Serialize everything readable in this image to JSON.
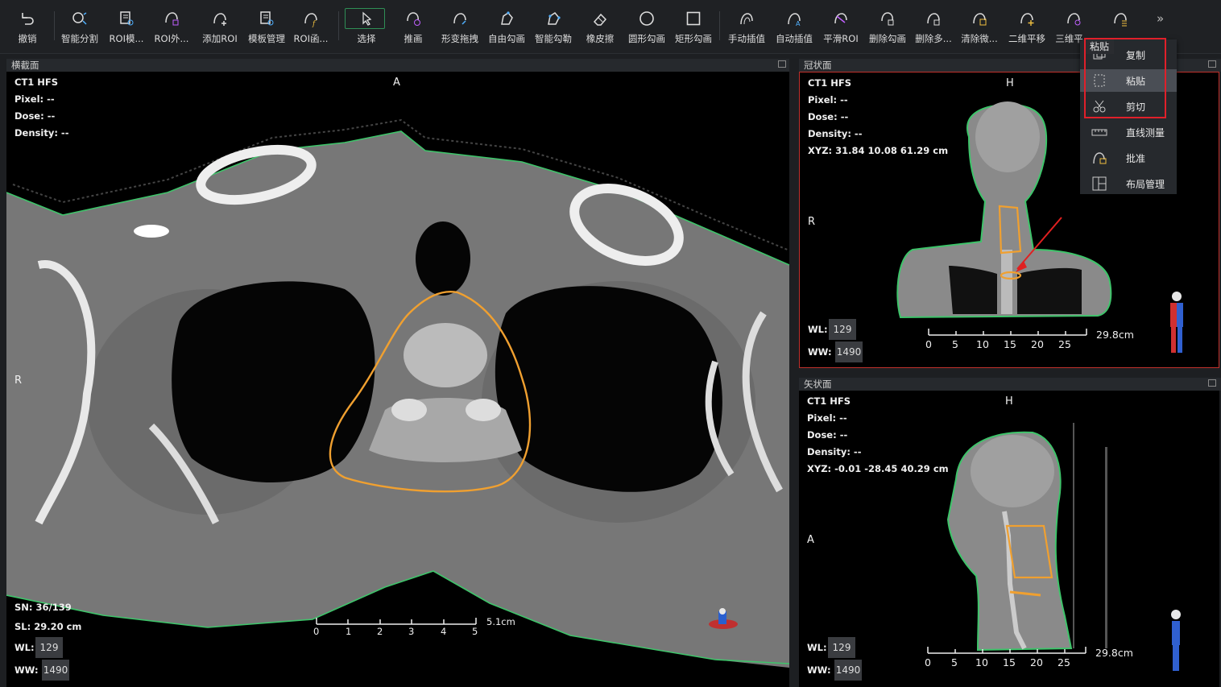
{
  "toolbar": {
    "items": [
      {
        "label": "撤销",
        "icon": "undo-icon"
      },
      {
        "label": "智能分割",
        "icon": "smart-segment-icon"
      },
      {
        "label": "ROI模...",
        "icon": "roi-template-icon"
      },
      {
        "label": "ROI外...",
        "icon": "roi-expand-icon"
      },
      {
        "label": "添加ROI",
        "icon": "add-roi-icon"
      },
      {
        "label": "模板管理",
        "icon": "template-manage-icon"
      },
      {
        "label": "ROI函...",
        "icon": "roi-function-icon"
      },
      {
        "label": "选择",
        "icon": "select-arrow-icon"
      },
      {
        "label": "推画",
        "icon": "push-draw-icon"
      },
      {
        "label": "形变拖拽",
        "icon": "deform-drag-icon"
      },
      {
        "label": "自由勾画",
        "icon": "free-draw-icon"
      },
      {
        "label": "智能勾勒",
        "icon": "smart-outline-icon"
      },
      {
        "label": "橡皮擦",
        "icon": "eraser-icon"
      },
      {
        "label": "圆形勾画",
        "icon": "circle-draw-icon"
      },
      {
        "label": "矩形勾画",
        "icon": "rect-draw-icon"
      },
      {
        "label": "手动插值",
        "icon": "manual-interp-icon"
      },
      {
        "label": "自动插值",
        "icon": "auto-interp-icon"
      },
      {
        "label": "平滑ROI",
        "icon": "smooth-roi-icon"
      },
      {
        "label": "删除勾画",
        "icon": "delete-draw-icon"
      },
      {
        "label": "删除多...",
        "icon": "delete-multi-icon"
      },
      {
        "label": "清除微...",
        "icon": "clear-small-icon"
      },
      {
        "label": "二维平移",
        "icon": "pan-2d-icon"
      },
      {
        "label": "三维平...",
        "icon": "pan-3d-icon"
      },
      {
        "label": "",
        "icon": "more-icon"
      }
    ],
    "more": "»"
  },
  "axial": {
    "title": "横截面",
    "modality": "CT1 HFS",
    "pixel": "Pixel:  --",
    "dose": "Dose:  --",
    "density": "Density:  --",
    "top": "A",
    "left": "R",
    "sn": "SN: 36/139",
    "sl": "SL: 29.20 cm",
    "wl_label": "WL:",
    "wl": "129",
    "ww_label": "WW:",
    "ww": "1490",
    "scale_ticks": [
      "0",
      "1",
      "2",
      "3",
      "4",
      "5"
    ],
    "scale_label": "5.1cm"
  },
  "coronal": {
    "title": "冠状面",
    "modality": "CT1 HFS",
    "pixel": "Pixel:  --",
    "dose": "Dose:  --",
    "density": "Density:  --",
    "xyz": "XYZ: 31.84 10.08 61.29 cm",
    "top": "H",
    "left": "R",
    "wl_label": "WL:",
    "wl": "129",
    "ww_label": "WW:",
    "ww": "1490",
    "scale_ticks": [
      "0",
      "5",
      "10",
      "15",
      "20",
      "25"
    ],
    "scale_label": "29.8cm"
  },
  "sagittal": {
    "title": "矢状面",
    "modality": "CT1 HFS",
    "pixel": "Pixel:  --",
    "dose": "Dose:  --",
    "density": "Density:  --",
    "xyz": "XYZ: -0.01 -28.45 40.29 cm",
    "top": "H",
    "left": "A",
    "wl_label": "WL:",
    "wl": "129",
    "ww_label": "WW:",
    "ww": "1490",
    "scale_ticks": [
      "0",
      "5",
      "10",
      "15",
      "20",
      "25"
    ],
    "scale_label": "29.8cm"
  },
  "context_menu": {
    "tooltip": "粘贴",
    "items": [
      {
        "label": "复制",
        "icon": "copy-icon"
      },
      {
        "label": "粘贴",
        "icon": "paste-icon"
      },
      {
        "label": "剪切",
        "icon": "scissors-icon"
      },
      {
        "label": "直线测量",
        "icon": "ruler-icon"
      },
      {
        "label": "批准",
        "icon": "approve-icon"
      },
      {
        "label": "布局管理",
        "icon": "layout-icon"
      }
    ]
  },
  "colors": {
    "roi_orange": "#f0a030",
    "body_green": "#3ec46a",
    "active_border": "#c0302c",
    "highlight_red": "#e0202a"
  }
}
